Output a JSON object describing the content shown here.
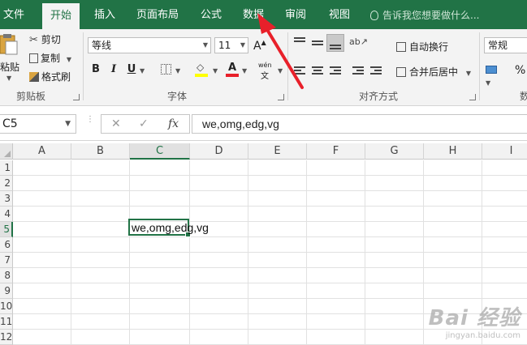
{
  "tabs": [
    {
      "label": "文件",
      "active": false
    },
    {
      "label": "开始",
      "active": true
    },
    {
      "label": "插入",
      "active": false
    },
    {
      "label": "页面布局",
      "active": false
    },
    {
      "label": "公式",
      "active": false
    },
    {
      "label": "数据",
      "active": false
    },
    {
      "label": "审阅",
      "active": false
    },
    {
      "label": "视图",
      "active": false
    }
  ],
  "tell_me": "告诉我您想要做什么...",
  "clipboard": {
    "paste": "粘贴",
    "cut": "剪切",
    "copy": "复制",
    "format_painter": "格式刷",
    "label": "剪贴板"
  },
  "font": {
    "name": "等线",
    "size": "11",
    "bold": "B",
    "italic": "I",
    "underline": "U",
    "grow": "A",
    "font_color": "A",
    "phonetic": "wén",
    "label": "字体"
  },
  "alignment": {
    "wrap_text": "自动换行",
    "merge_center": "合并后居中",
    "label": "对齐方式"
  },
  "number": {
    "format": "常规",
    "percent": "%",
    "label_partial": "数"
  },
  "formula_bar": {
    "name_box": "C5",
    "cancel": "✕",
    "enter": "✓",
    "fx": "fx",
    "content": "we,omg,edg,vg"
  },
  "grid": {
    "columns": [
      "A",
      "B",
      "C",
      "D",
      "E",
      "F",
      "G",
      "H",
      "I"
    ],
    "selected_column": "C",
    "rows": [
      "1",
      "2",
      "3",
      "4",
      "5",
      "6",
      "7",
      "8",
      "9",
      "10",
      "11",
      "12"
    ],
    "selected_row": "5",
    "active_cell_value": "we,omg,edg,vg"
  },
  "watermark": {
    "main": "Bai 经验",
    "sub": "jingyan.baidu.com"
  },
  "colors": {
    "excel_green": "#217346",
    "arrow_red": "#e8202a"
  }
}
